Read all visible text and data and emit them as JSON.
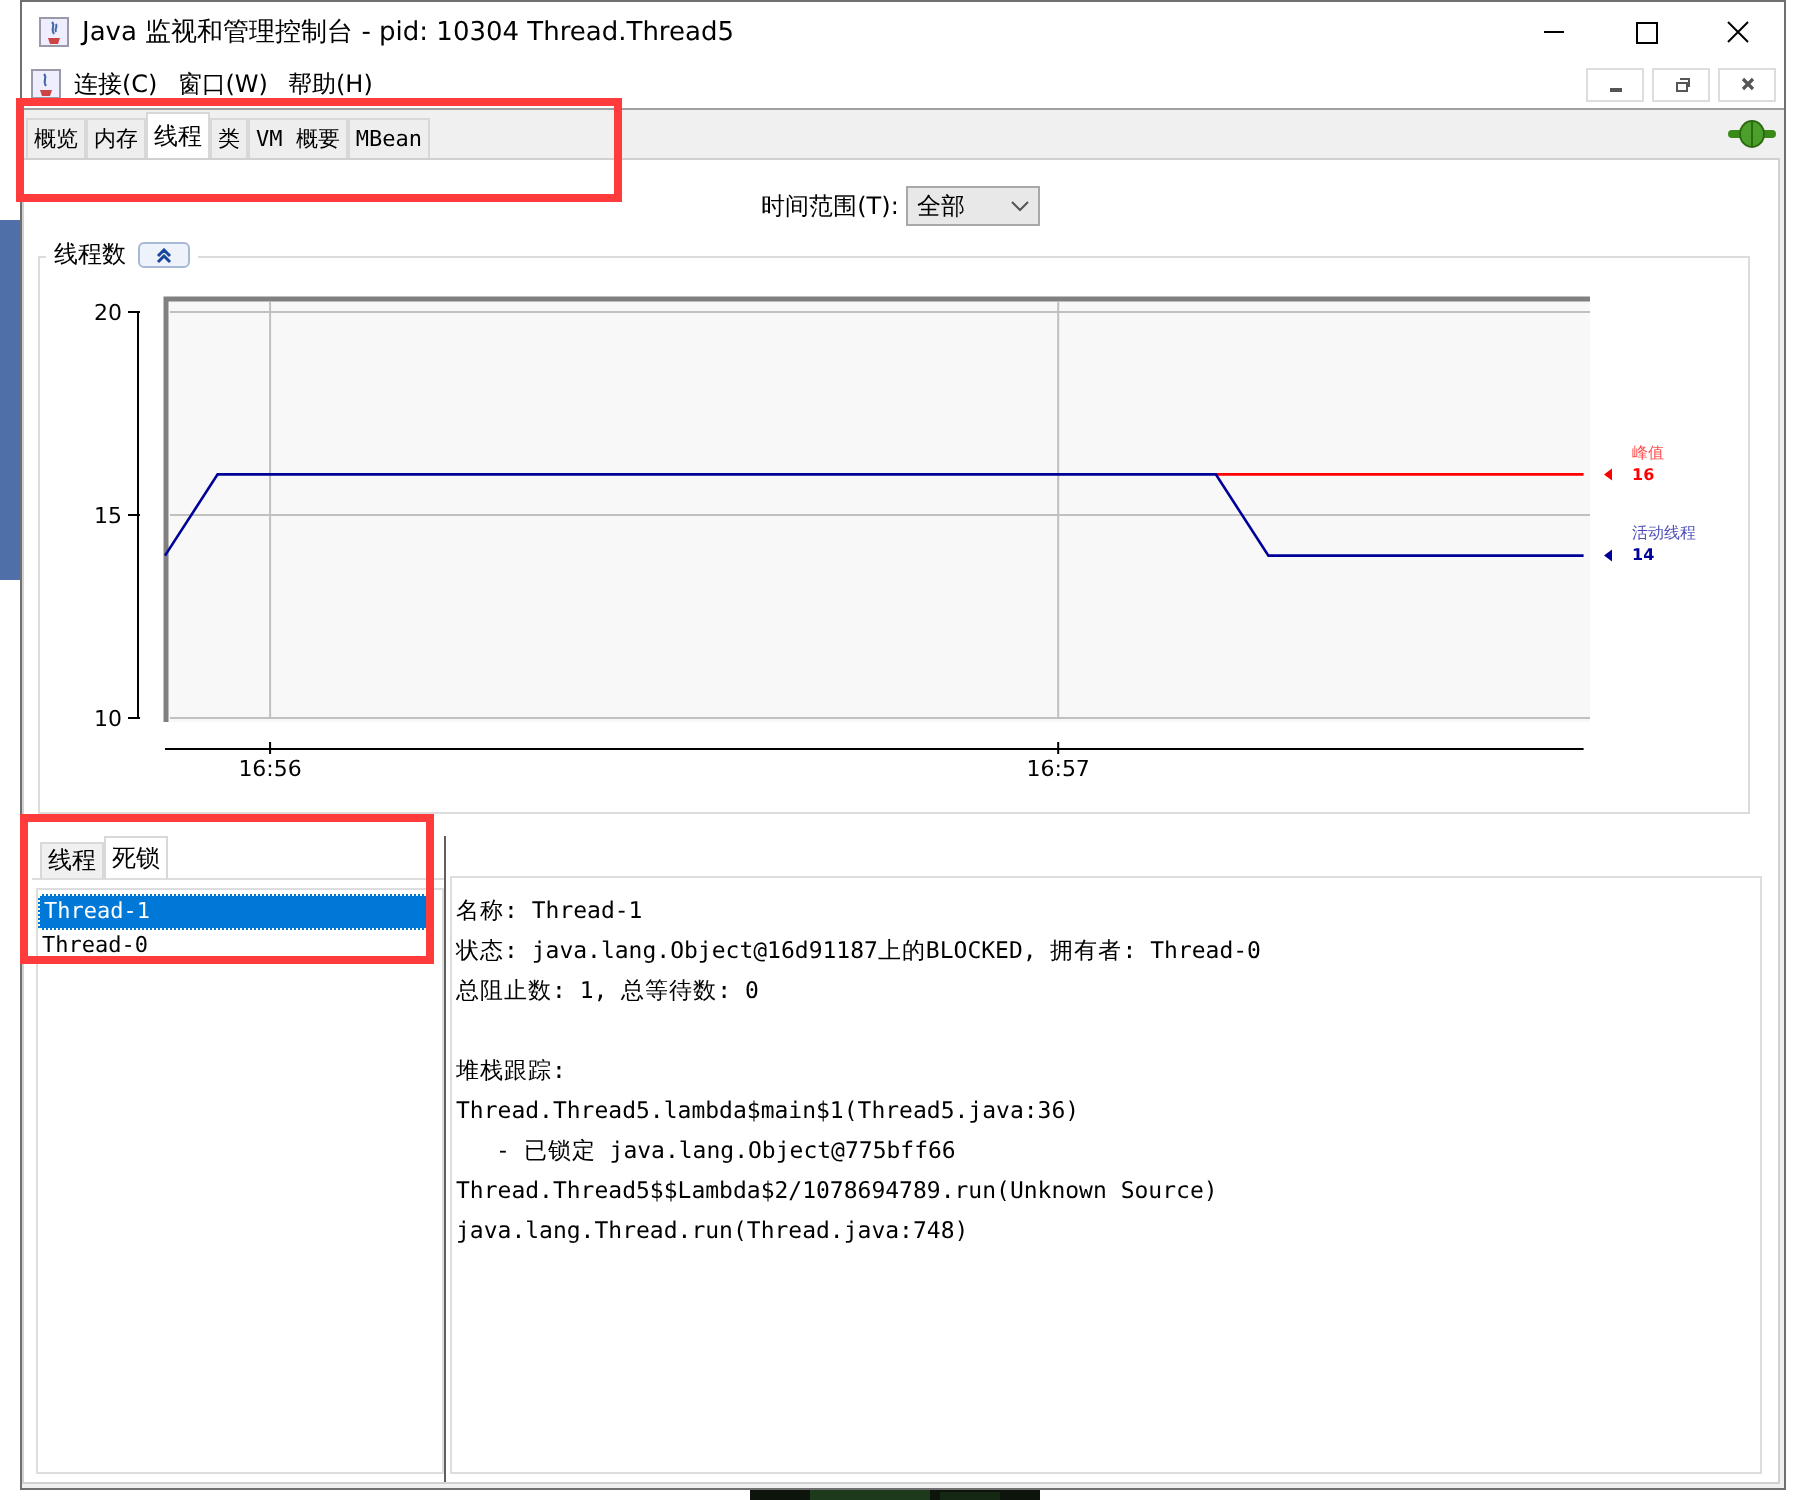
{
  "window": {
    "title": "Java 监视和管理控制台 - pid: 10304 Thread.Thread5"
  },
  "menu": [
    "连接(C)",
    "窗口(W)",
    "帮助(H)"
  ],
  "tabs": [
    {
      "label": "概览",
      "selected": false
    },
    {
      "label": "内存",
      "selected": false
    },
    {
      "label": "线程",
      "selected": true
    },
    {
      "label": "类",
      "selected": false
    },
    {
      "label": "VM 概要",
      "selected": false
    },
    {
      "label": "MBean",
      "selected": false
    }
  ],
  "time_range": {
    "label": "时间范围(T):",
    "value": "全部"
  },
  "chart_panel": {
    "title": "线程数",
    "expanded": true,
    "current_values": [
      "16",
      "14"
    ],
    "chart_data": {
      "type": "line",
      "grid": true,
      "categories": [
        null,
        null,
        "16:56",
        null,
        null,
        null,
        null,
        null,
        null,
        null,
        null,
        null,
        null,
        null,
        null,
        null,
        null,
        "16:57",
        null,
        null,
        null,
        null,
        null,
        null,
        null,
        null,
        null,
        null
      ],
      "ylim": [
        10,
        20
      ],
      "yticks": [
        10,
        15,
        20
      ],
      "series": [
        {
          "name": "峰值",
          "color": "#ff0000",
          "values": [
            null,
            null,
            null,
            null,
            null,
            null,
            null,
            null,
            null,
            null,
            null,
            null,
            null,
            null,
            null,
            null,
            null,
            null,
            null,
            null,
            16,
            16,
            16,
            16,
            16,
            16,
            16,
            16
          ]
        },
        {
          "name": "活动线程",
          "color": "#000099",
          "values": [
            14,
            16,
            16,
            16,
            16,
            16,
            16,
            16,
            16,
            16,
            16,
            16,
            16,
            16,
            16,
            16,
            16,
            16,
            16,
            16,
            16,
            14,
            14,
            14,
            14,
            14,
            14,
            14
          ]
        }
      ]
    }
  },
  "sub_tabs": [
    {
      "label": "线程",
      "selected": false
    },
    {
      "label": "死锁",
      "selected": true
    }
  ],
  "threads": [
    {
      "name": "Thread-1",
      "selected": true
    },
    {
      "name": "Thread-0",
      "selected": false
    }
  ],
  "details": {
    "info": [
      "名称: Thread-1",
      "状态: java.lang.Object@16d91187上的BLOCKED, 拥有者: Thread-0",
      "总阻止数: 1, 总等待数: 0"
    ],
    "stack_title": "堆栈跟踪:",
    "stack": [
      {
        "kind": "frame",
        "text": "Thread.Thread5.lambda$main$1(Thread5.java:36)"
      },
      {
        "kind": "lock",
        "text": "- 已锁定 java.lang.Object@775bff66"
      },
      {
        "kind": "frame",
        "text": "Thread.Thread5$$Lambda$2/1078694789.run(Unknown Source)"
      },
      {
        "kind": "frame",
        "text": "java.lang.Thread.run(Thread.java:748)"
      }
    ]
  }
}
